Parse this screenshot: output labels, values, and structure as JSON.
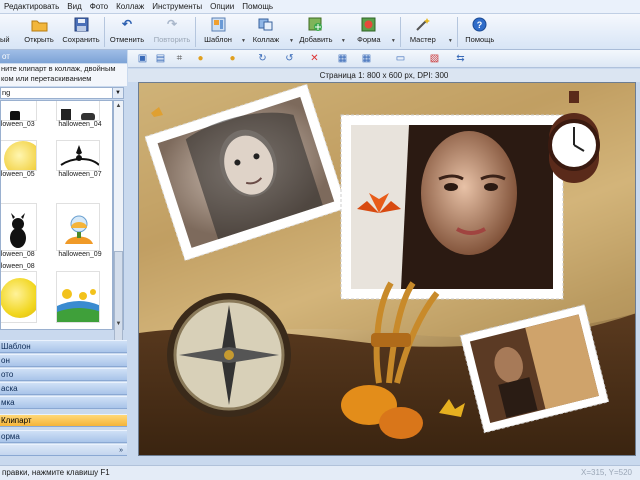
{
  "menu": [
    "Редактировать",
    "Вид",
    "Фото",
    "Коллаж",
    "Инструменты",
    "Опции",
    "Помощь"
  ],
  "toolbar": {
    "new_label": "ый",
    "open_label": "Открыть",
    "save_label": "Сохранить",
    "undo_label": "Отменить",
    "redo_label": "Повторить",
    "template_label": "Шаблон",
    "collage_label": "Коллаж",
    "add_label": "Добавить",
    "shape_label": "Форма",
    "wizard_label": "Мастер",
    "help_label": "Помощь"
  },
  "left_panel": {
    "header": "от",
    "hint": "ните клипарт в коллаж, двойным\nком или перетаскиванием",
    "category": "ng",
    "gallery": [
      {
        "label": "lloween_03"
      },
      {
        "label": "halloween_04"
      },
      {
        "label": "lloween_05"
      },
      {
        "label": "halloween_07"
      },
      {
        "label": "lloween_08"
      },
      {
        "label": "halloween_09"
      }
    ],
    "accordion": [
      "Шаблон",
      "он",
      "ото",
      "аска",
      "мка",
      "Клипарт",
      "орма"
    ]
  },
  "page_info": "Страница 1: 800 x 600 px, DPI: 300",
  "status": {
    "hint": "правки, нажмите клавишу F1",
    "coords": "X=315, Y=520"
  },
  "colors": {
    "accent": "#f5b43a",
    "panel": "#c9d9ee",
    "header": "#7da3d6"
  }
}
